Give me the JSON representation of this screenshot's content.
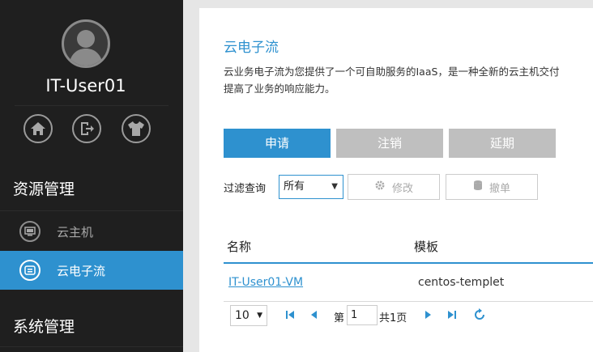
{
  "user": {
    "name": "IT-User01"
  },
  "quick_icons": [
    "home-icon",
    "logout-icon",
    "tshirt-icon"
  ],
  "sidebar": {
    "sections": [
      {
        "title": "资源管理",
        "items": [
          {
            "label": "云主机",
            "icon": "vm-icon",
            "active": false
          },
          {
            "label": "云电子流",
            "icon": "flow-icon",
            "active": true
          }
        ]
      },
      {
        "title": "系统管理",
        "items": []
      }
    ]
  },
  "main": {
    "title": "云电子流",
    "description_line1": "云业务电子流为您提供了一个可自助服务的IaaS，是一种全新的云主机交付",
    "description_line2": "提高了业务的响应能力。",
    "actions": {
      "apply": "申请",
      "cancel": "注销",
      "extend": "延期"
    },
    "filter": {
      "label": "过滤查询",
      "selected": "所有",
      "modify_label": "修改",
      "revoke_label": "撤单"
    },
    "table": {
      "columns": [
        "名称",
        "模板"
      ],
      "rows": [
        {
          "name": "IT-User01-VM",
          "template": "centos-templet"
        }
      ]
    },
    "pagination": {
      "page_size": "10",
      "page_prefix": "第",
      "current_page": "1",
      "total_text": "共1页"
    }
  },
  "colors": {
    "accent": "#2e91cf",
    "sidebar_bg": "#1f1f1f",
    "button_gray": "#bfbfbf"
  }
}
